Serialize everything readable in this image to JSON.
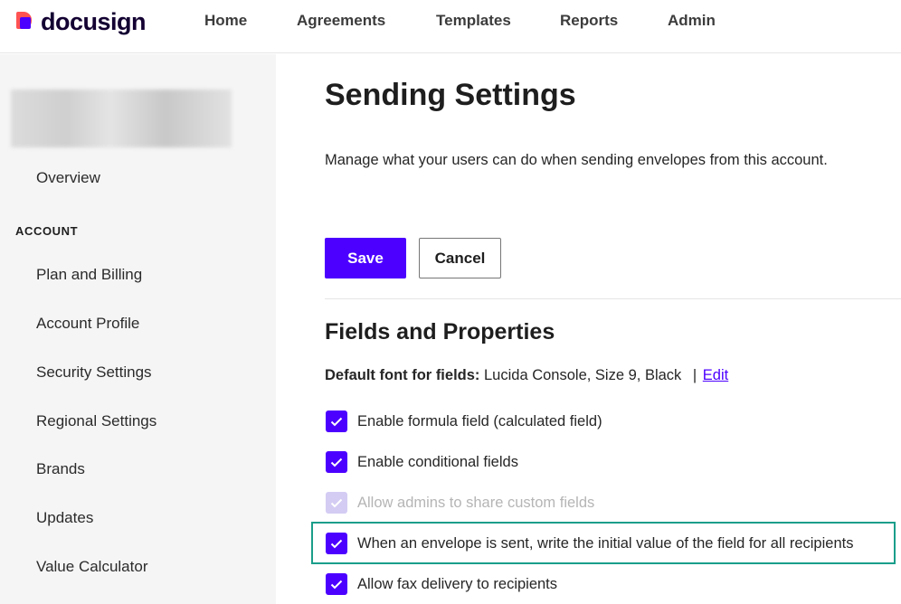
{
  "header": {
    "logo_text": "docusign",
    "nav": [
      "Home",
      "Agreements",
      "Templates",
      "Reports",
      "Admin"
    ]
  },
  "sidebar": {
    "overview": "Overview",
    "section_header": "ACCOUNT",
    "items": [
      "Plan and Billing",
      "Account Profile",
      "Security Settings",
      "Regional Settings",
      "Brands",
      "Updates",
      "Value Calculator"
    ]
  },
  "main": {
    "title": "Sending Settings",
    "description": "Manage what your users can do when sending envelopes from this account.",
    "save_label": "Save",
    "cancel_label": "Cancel",
    "section_title": "Fields and Properties",
    "default_font_label": "Default font for fields:",
    "default_font_value": "Lucida Console, Size 9, Black",
    "separator": "|",
    "edit_link": "Edit",
    "options": [
      {
        "label": "Enable formula field (calculated field)",
        "checked": true,
        "disabled": false
      },
      {
        "label": "Enable conditional fields",
        "checked": true,
        "disabled": false
      },
      {
        "label": "Allow admins to share custom fields",
        "checked": true,
        "disabled": true
      },
      {
        "label": "When an envelope is sent, write the initial value of the field for all recipients",
        "checked": true,
        "disabled": false
      },
      {
        "label": "Allow fax delivery to recipients",
        "checked": true,
        "disabled": false
      }
    ]
  },
  "colors": {
    "accent": "#4c00ff",
    "highlight": "#1a9e8a",
    "sidebar_bg": "#f5f5f5"
  }
}
